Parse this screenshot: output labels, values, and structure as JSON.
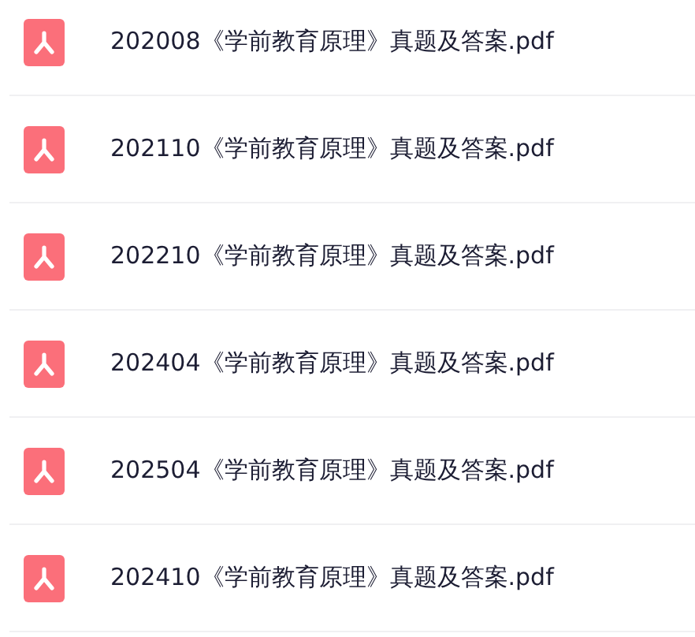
{
  "files": [
    {
      "name": "202008《学前教育原理》真题及答案.pdf"
    },
    {
      "name": "202110《学前教育原理》真题及答案.pdf"
    },
    {
      "name": "202210《学前教育原理》真题及答案.pdf"
    },
    {
      "name": "202404《学前教育原理》真题及答案.pdf"
    },
    {
      "name": "202504《学前教育原理》真题及答案.pdf"
    },
    {
      "name": "202410《学前教育原理》真题及答案.pdf"
    }
  ]
}
